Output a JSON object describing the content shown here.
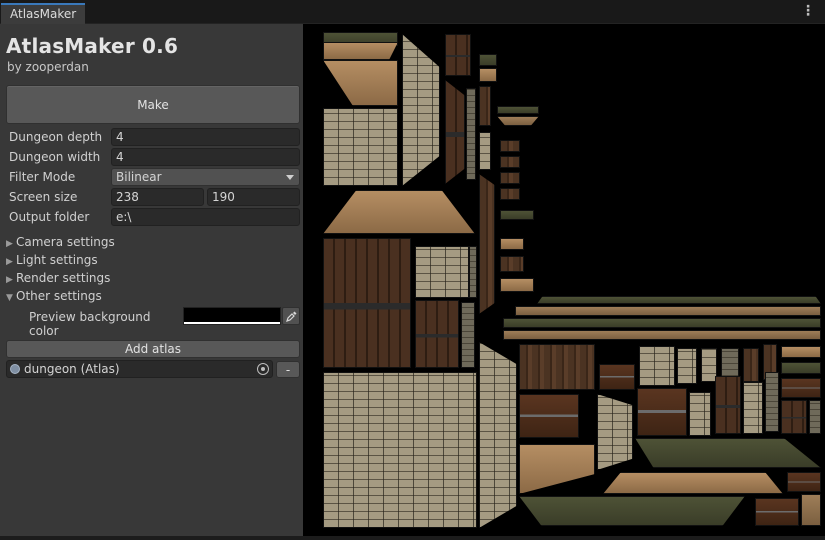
{
  "tab": {
    "label": "AtlasMaker",
    "menu_glyph": "⋮"
  },
  "header": {
    "title": "AtlasMaker 0.6",
    "subtitle": "by zooperdan"
  },
  "make_button": "Make",
  "fields": {
    "dungeon_depth": {
      "label": "Dungeon depth",
      "value": "4"
    },
    "dungeon_width": {
      "label": "Dungeon width",
      "value": "4"
    },
    "filter_mode": {
      "label": "Filter Mode",
      "value": "Bilinear"
    },
    "screen_size": {
      "label": "Screen size",
      "x": "238",
      "y": "190"
    },
    "output_folder": {
      "label": "Output folder",
      "value": "e:\\"
    }
  },
  "foldouts": {
    "camera": {
      "label": "Camera settings",
      "expanded": false
    },
    "light": {
      "label": "Light settings",
      "expanded": false
    },
    "render": {
      "label": "Render settings",
      "expanded": false
    },
    "other": {
      "label": "Other settings",
      "expanded": true
    }
  },
  "other_settings": {
    "preview_bg_label": "Preview background color",
    "preview_bg_color": "#000000"
  },
  "add_atlas_button": "Add atlas",
  "atlas_entry": {
    "value": "dungeon (Atlas)",
    "remove_label": "-"
  },
  "icons": {
    "foldout_collapsed": "▶",
    "foldout_expanded": "▼",
    "eyedropper": "eyedropper-icon",
    "object_picker": "target-icon"
  }
}
